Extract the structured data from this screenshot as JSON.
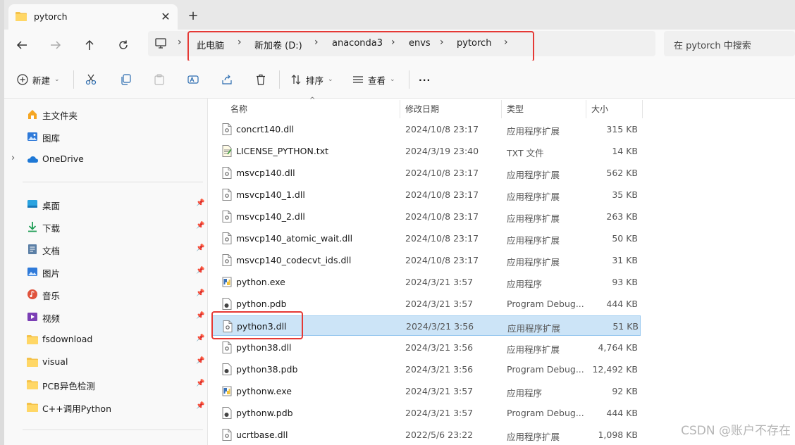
{
  "tab": {
    "title": "pytorch"
  },
  "breadcrumb": [
    "此电脑",
    "新加卷 (D:)",
    "anaconda3",
    "envs",
    "pytorch"
  ],
  "search": {
    "placeholder": "在 pytorch 中搜索"
  },
  "toolbar": {
    "new_label": "新建",
    "sort_label": "排序",
    "view_label": "查看",
    "more_label": "···"
  },
  "sidebar": {
    "top": [
      {
        "label": "主文件夹",
        "icon": "home-icon"
      },
      {
        "label": "图库",
        "icon": "gallery-icon"
      },
      {
        "label": "OneDrive",
        "icon": "cloud-icon"
      }
    ],
    "pinned": [
      {
        "label": "桌面",
        "icon": "desktop-icon"
      },
      {
        "label": "下载",
        "icon": "download-icon"
      },
      {
        "label": "文档",
        "icon": "document-icon"
      },
      {
        "label": "图片",
        "icon": "picture-icon"
      },
      {
        "label": "音乐",
        "icon": "music-icon"
      },
      {
        "label": "视频",
        "icon": "video-icon"
      },
      {
        "label": "fsdownload",
        "icon": "folder-icon"
      },
      {
        "label": "visual",
        "icon": "folder-icon"
      },
      {
        "label": "PCB异色检测",
        "icon": "folder-icon"
      },
      {
        "label": "C++调用Python",
        "icon": "folder-icon"
      }
    ]
  },
  "columns": {
    "name": "名称",
    "date": "修改日期",
    "type": "类型",
    "size": "大小"
  },
  "files": [
    {
      "name": "concrt140.dll",
      "date": "2024/10/8 23:17",
      "type": "应用程序扩展",
      "size": "315 KB",
      "kind": "dll"
    },
    {
      "name": "LICENSE_PYTHON.txt",
      "date": "2024/3/19 23:40",
      "type": "TXT 文件",
      "size": "14 KB",
      "kind": "txt"
    },
    {
      "name": "msvcp140.dll",
      "date": "2024/10/8 23:17",
      "type": "应用程序扩展",
      "size": "562 KB",
      "kind": "dll"
    },
    {
      "name": "msvcp140_1.dll",
      "date": "2024/10/8 23:17",
      "type": "应用程序扩展",
      "size": "35 KB",
      "kind": "dll"
    },
    {
      "name": "msvcp140_2.dll",
      "date": "2024/10/8 23:17",
      "type": "应用程序扩展",
      "size": "263 KB",
      "kind": "dll"
    },
    {
      "name": "msvcp140_atomic_wait.dll",
      "date": "2024/10/8 23:17",
      "type": "应用程序扩展",
      "size": "50 KB",
      "kind": "dll"
    },
    {
      "name": "msvcp140_codecvt_ids.dll",
      "date": "2024/10/8 23:17",
      "type": "应用程序扩展",
      "size": "31 KB",
      "kind": "dll"
    },
    {
      "name": "python.exe",
      "date": "2024/3/21 3:57",
      "type": "应用程序",
      "size": "93 KB",
      "kind": "exe"
    },
    {
      "name": "python.pdb",
      "date": "2024/3/21 3:57",
      "type": "Program Debug...",
      "size": "444 KB",
      "kind": "pdb"
    },
    {
      "name": "python3.dll",
      "date": "2024/3/21 3:56",
      "type": "应用程序扩展",
      "size": "51 KB",
      "kind": "dll"
    },
    {
      "name": "python38.dll",
      "date": "2024/3/21 3:56",
      "type": "应用程序扩展",
      "size": "4,764 KB",
      "kind": "dll"
    },
    {
      "name": "python38.pdb",
      "date": "2024/3/21 3:56",
      "type": "Program Debug...",
      "size": "12,492 KB",
      "kind": "pdb"
    },
    {
      "name": "pythonw.exe",
      "date": "2024/3/21 3:57",
      "type": "应用程序",
      "size": "92 KB",
      "kind": "exe"
    },
    {
      "name": "pythonw.pdb",
      "date": "2024/3/21 3:57",
      "type": "Program Debug...",
      "size": "444 KB",
      "kind": "pdb"
    },
    {
      "name": "ucrtbase.dll",
      "date": "2022/5/6 23:22",
      "type": "应用程序扩展",
      "size": "1,098 KB",
      "kind": "dll"
    }
  ],
  "selected_file": "python3.dll",
  "watermark": "CSDN @账户不存在",
  "colors": {
    "highlight_border": "#e53935",
    "selection": "#cce4f7",
    "folder": "#f4c24a"
  }
}
